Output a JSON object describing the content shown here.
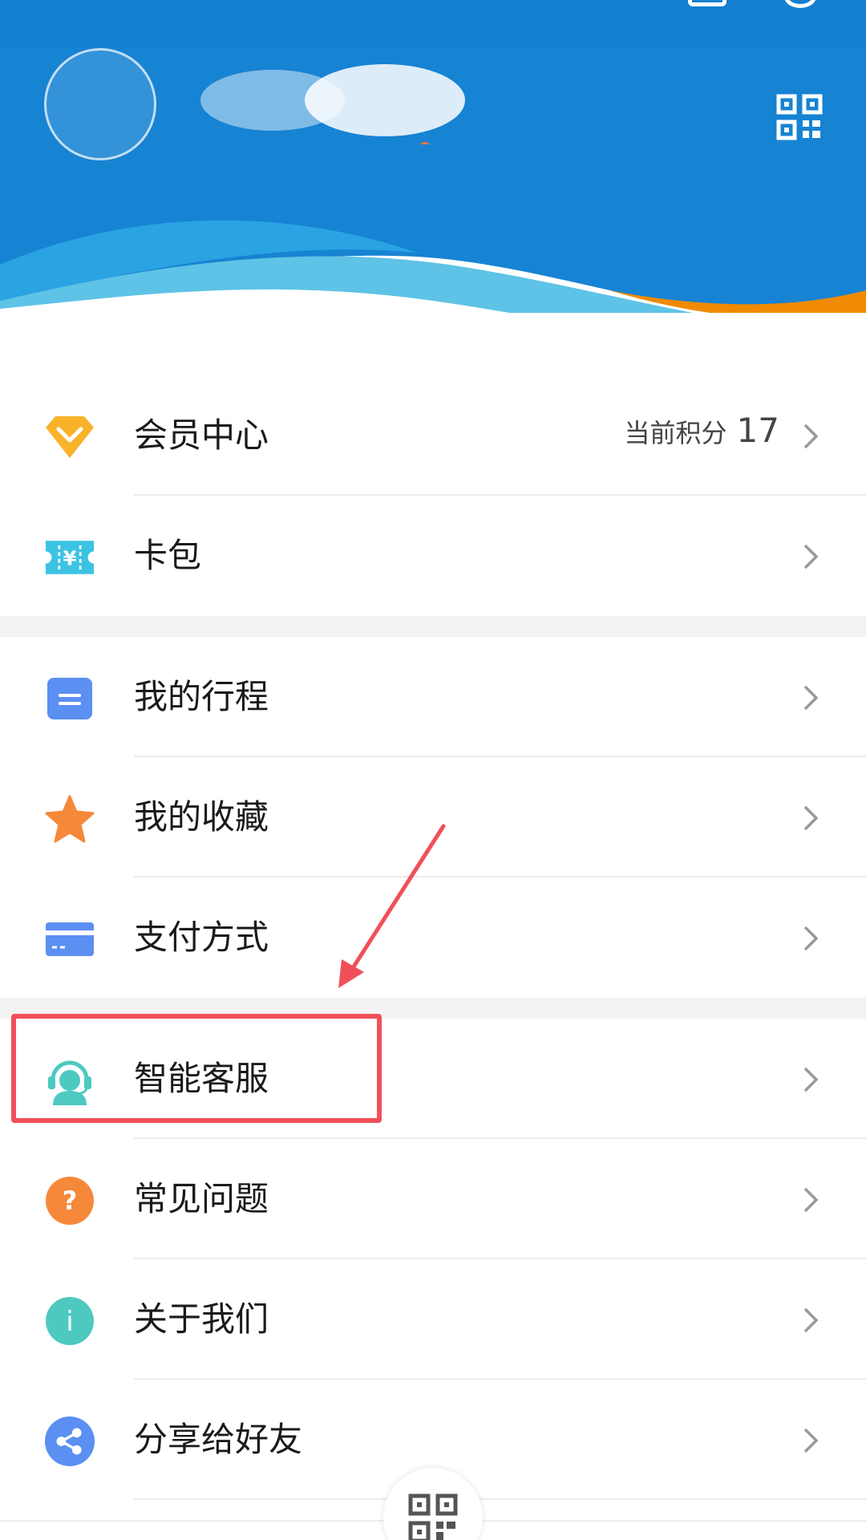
{
  "header": {
    "qr_icon": "qr-code-icon",
    "colors": {
      "primary": "#1783d3",
      "wave_light": "#5ec3e6",
      "accent": "#f08a00"
    }
  },
  "menu": {
    "groups": [
      {
        "items": [
          {
            "label": "会员中心",
            "icon": "diamond-icon",
            "extra_label": "当前积分",
            "extra_value": "17"
          },
          {
            "label": "卡包",
            "icon": "ticket-yuan-icon"
          }
        ]
      },
      {
        "items": [
          {
            "label": "我的行程",
            "icon": "itinerary-icon"
          },
          {
            "label": "我的收藏",
            "icon": "star-icon"
          },
          {
            "label": "支付方式",
            "icon": "credit-card-icon"
          }
        ]
      },
      {
        "items": [
          {
            "label": "智能客服",
            "icon": "customer-service-icon"
          },
          {
            "label": "常见问题",
            "icon": "question-icon"
          },
          {
            "label": "关于我们",
            "icon": "info-icon"
          },
          {
            "label": "分享给好友",
            "icon": "share-icon"
          }
        ]
      }
    ],
    "ticket_symbol": "¥",
    "question_symbol": "?",
    "info_symbol": "i"
  },
  "annotation": {
    "color": "#f0505a"
  },
  "bottom": {
    "scan_icon": "qr-scan-icon"
  }
}
